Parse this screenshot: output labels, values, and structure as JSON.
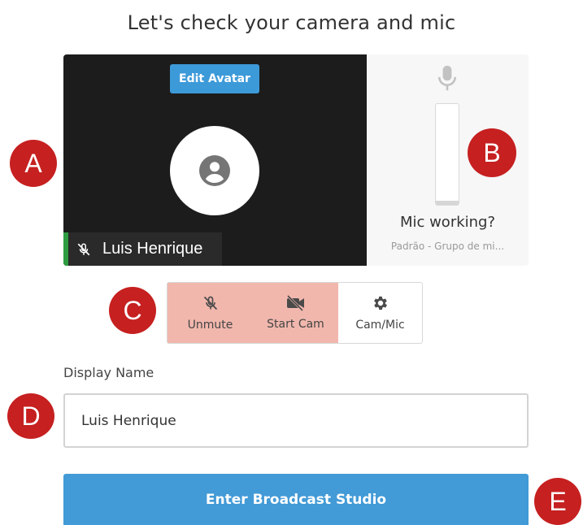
{
  "title": "Let's check your camera and mic",
  "video": {
    "edit_avatar_label": "Edit Avatar",
    "name_tag": "Luis Henrique"
  },
  "mic": {
    "question": "Mic working?",
    "device": "Padrão - Grupo de mi...",
    "level": 0.04
  },
  "controls": {
    "unmute_label": "Unmute",
    "start_cam_label": "Start Cam",
    "cam_mic_label": "Cam/Mic"
  },
  "display_name": {
    "label": "Display Name",
    "value": "Luis Henrique"
  },
  "enter_button_label": "Enter Broadcast Studio",
  "markers": {
    "a": "A",
    "b": "B",
    "c": "C",
    "d": "D",
    "e": "E"
  },
  "colors": {
    "primary": "#429ad6",
    "muted_bg": "#f1b7ad",
    "marker": "#c62020",
    "video_bg": "#1c1c1c",
    "active_indicator": "#2e9d41"
  }
}
